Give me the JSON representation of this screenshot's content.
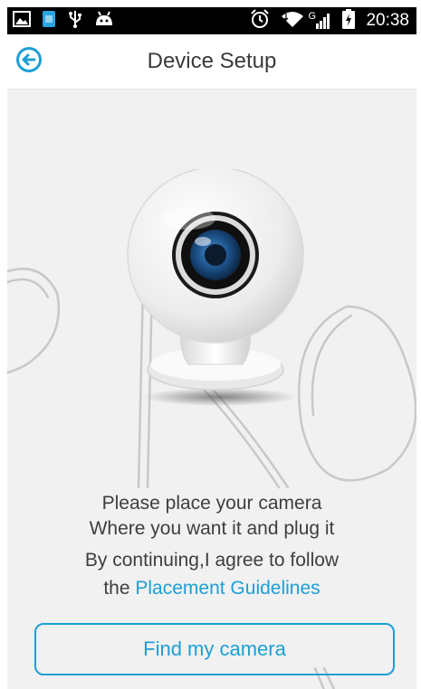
{
  "status_bar": {
    "time": "20:38",
    "network_label": "G",
    "left_icons": [
      "gallery-icon",
      "sim-card-icon",
      "usb-icon",
      "android-icon"
    ],
    "right_icons": [
      "alarm-icon",
      "wifi-icon",
      "signal-icon",
      "battery-charging-icon"
    ]
  },
  "header": {
    "back_icon": "back-arrow-icon",
    "title": "Device Setup"
  },
  "main": {
    "instruction_line1": "Please place your camera",
    "instruction_line2": "Where you want it and plug it",
    "agree_line1": "By continuing,I agree to follow",
    "agree_prefix": "the ",
    "guidelines_link": "Placement Guidelines",
    "find_button": "Find my camera"
  },
  "colors": {
    "accent": "#1c9fd6",
    "background": "#f1f1f1",
    "status_bar": "#000000"
  }
}
